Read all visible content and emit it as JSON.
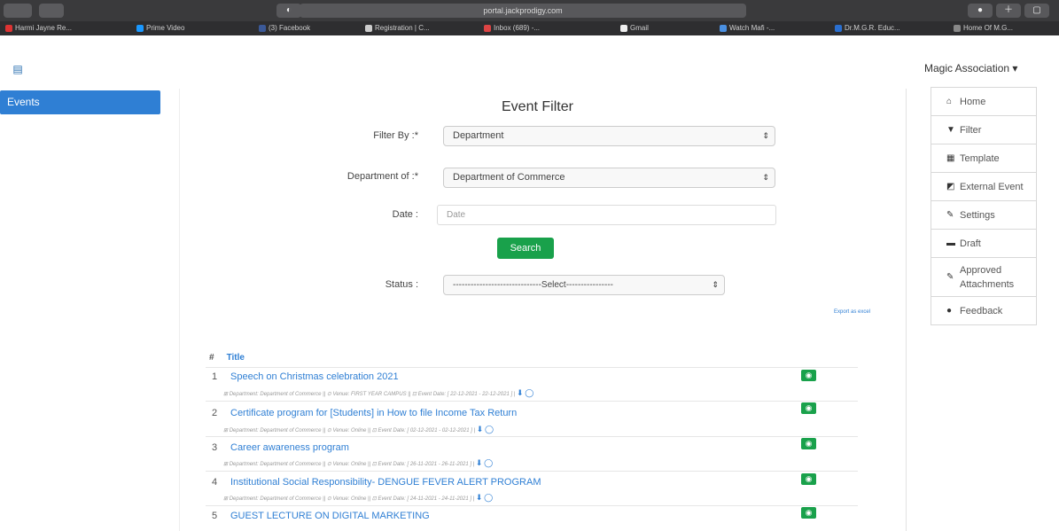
{
  "browser": {
    "url": "portal.jackprodigy.com",
    "bookmarks": [
      {
        "label": "Harmi Jayne Re...",
        "color": "#d33"
      },
      {
        "label": "Prime Video",
        "color": "#1a98ff"
      },
      {
        "label": "(3) Facebook",
        "color": "#3b5998"
      },
      {
        "label": "Registration | C...",
        "color": "#ccc"
      },
      {
        "label": "Inbox (689) -...",
        "color": "#d44"
      },
      {
        "label": "Gmail",
        "color": "#eee"
      },
      {
        "label": "Watch Mafi -...",
        "color": "#4a90e2"
      },
      {
        "label": "Dr.M.G.R. Educ...",
        "color": "#2a6fd0"
      },
      {
        "label": "Home Of M.G...",
        "color": "#888"
      }
    ]
  },
  "sidebar": {
    "menu_icon": "menu-icon",
    "active_item": "Events"
  },
  "account": {
    "label": "Magic Association ▾"
  },
  "right_menu": [
    {
      "icon": "home-icon",
      "glyph": "⌂",
      "label": "Home"
    },
    {
      "icon": "filter-icon",
      "glyph": "▼",
      "label": "Filter"
    },
    {
      "icon": "template-icon",
      "glyph": "▦",
      "label": "Template"
    },
    {
      "icon": "external-link-icon",
      "glyph": "◩",
      "label": "External Event"
    },
    {
      "icon": "wrench-icon",
      "glyph": "✎",
      "label": "Settings"
    },
    {
      "icon": "folder-icon",
      "glyph": "▬",
      "label": "Draft"
    },
    {
      "icon": "paperclip-icon",
      "glyph": "✎",
      "label": "Approved Attachments"
    },
    {
      "icon": "comment-icon",
      "glyph": "●",
      "label": "Feedback"
    }
  ],
  "form": {
    "title": "Event Filter",
    "filter_by_label": "Filter By :*",
    "filter_by_value": "Department",
    "department_label": "Department of :*",
    "department_value": "Department of Commerce",
    "date_label": "Date :",
    "date_placeholder": "Date",
    "search_label": "Search",
    "status_label": "Status :",
    "status_value": "------------------------------Select----------------",
    "export_label": "Export as excel"
  },
  "list": {
    "hash": "#",
    "title_header": "Title",
    "rows": [
      {
        "num": "1",
        "title": "Speech on Christmas celebration 2021",
        "meta": "⊞ Department: Department of Commerce || ⊙ Venue: FIRST YEAR CAMPUS || ⊡ Event Date: [ 22-12-2021 - 22-12-2021 ] |"
      },
      {
        "num": "2",
        "title": "Certificate program for [Students] in How to file Income Tax Return",
        "meta": "⊞ Department: Department of Commerce || ⊙ Venue: Online || ⊡ Event Date: [ 02-12-2021 - 02-12-2021 ] |"
      },
      {
        "num": "3",
        "title": "Career awareness program",
        "meta": "⊞ Department: Department of Commerce || ⊙ Venue: Online || ⊡ Event Date: [ 26-11-2021 - 26-11-2021 ] |"
      },
      {
        "num": "4",
        "title": "Institutional Social Responsibility- DENGUE FEVER ALERT PROGRAM",
        "meta": "⊞ Department: Department of Commerce || ⊙ Venue: Online || ⊡ Event Date: [ 24-11-2021 - 24-11-2021 ] |"
      },
      {
        "num": "5",
        "title": "GUEST LECTURE ON DIGITAL MARKETING",
        "meta": ""
      }
    ]
  }
}
